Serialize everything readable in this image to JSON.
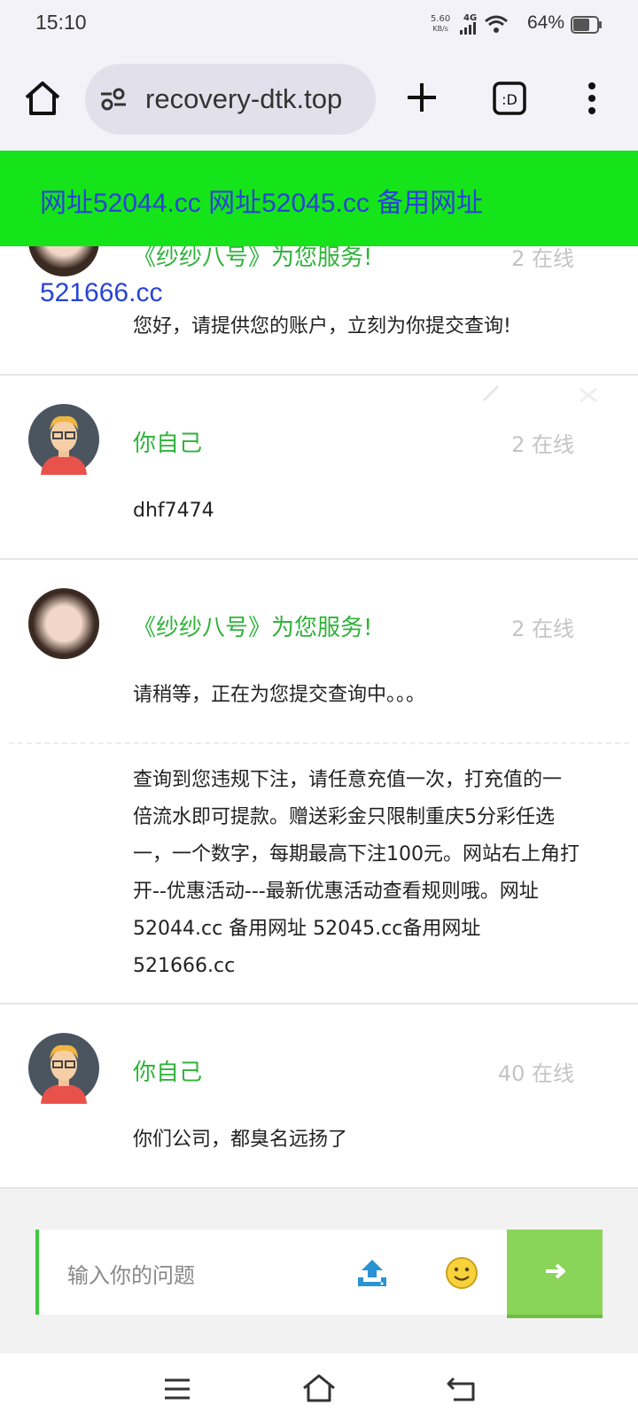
{
  "status_bar": {
    "time": "15:10",
    "net_speed_value": "5.60",
    "net_speed_unit": "KB/s",
    "network": "4G",
    "battery": "64%"
  },
  "browser": {
    "url": "recovery-dtk.top"
  },
  "banner": {
    "line1": "网址52044.cc 网址52045.cc 备用网址",
    "line2": "521666.cc"
  },
  "messages": [
    {
      "name": "《纱纱八号》为您服务!",
      "online": "2 在线",
      "texts": [
        "您好，请提供您的账户，立刻为你提交查询!"
      ]
    },
    {
      "name": "你自己",
      "online": "2 在线",
      "texts": [
        "dhf7474"
      ]
    },
    {
      "name": "《纱纱八号》为您服务!",
      "online": "2 在线",
      "texts": [
        "请稍等，正在为您提交查询中。。。",
        "查询到您违规下注，请任意充值一次，打充值的一倍流水即可提款。赠送彩金只限制重庆5分彩任选一，一个数字，每期最高下注100元。网站右上角打开--优惠活动---最新优惠活动查看规则哦。网址 52044.cc 备用网址 52045.cc备用网址 521666.cc"
      ]
    },
    {
      "name": "你自己",
      "online": "40 在线",
      "texts": [
        "你们公司，都臭名远扬了"
      ]
    }
  ],
  "input": {
    "placeholder": "输入你的问题"
  },
  "icons": {
    "home": "home-icon",
    "site_settings": "site-settings-icon",
    "new_tab": "plus-icon",
    "tabs": "tab-switcher-icon",
    "menu": "more-vert-icon",
    "upload": "upload-icon",
    "emoji": "smiley-icon",
    "send": "arrow-right-icon"
  },
  "colors": {
    "banner_bg": "#15e41a",
    "banner_text": "#2944d4",
    "name_green": "#2fb33a",
    "send_bg": "#8ad45a"
  }
}
